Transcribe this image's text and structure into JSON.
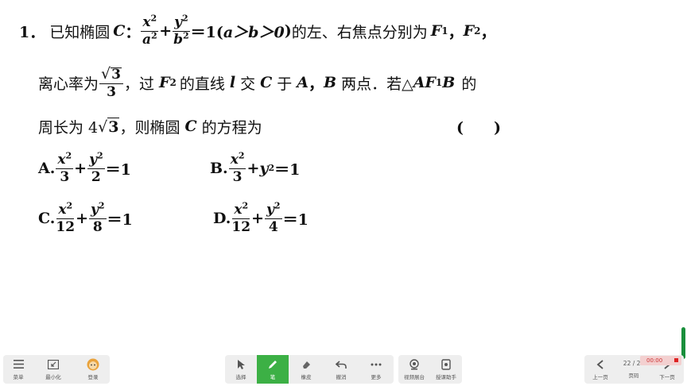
{
  "question": {
    "number": "1．",
    "line1": {
      "t1": "已知椭圆",
      "C": "C",
      "colon": "：",
      "x": "x",
      "two": "2",
      "a": "a",
      "plus": "+",
      "y": "y",
      "b": "b",
      "eq": "＝1(",
      "cond": "a＞b＞0",
      "close": ")",
      "t2": "的左、右焦点分别为",
      "F": "F",
      "one": "1",
      "comma": "，",
      "F2": "F",
      "two2": "2",
      "comma2": "，"
    },
    "line2": {
      "t1": "离心率为",
      "sqrt3": "3",
      "den": "3",
      "t2": "，过",
      "F": "F",
      "sub2": "2",
      "t3": "的直线",
      "l": "l",
      "t4": "交",
      "C": "C",
      "t5": "于",
      "A": "A",
      "comma": "，",
      "B": "B",
      "t6": "两点．若△",
      "AF": "AF",
      "sub1": "1",
      "B2": "B",
      "t7": "的"
    },
    "line3": {
      "t1": "周长为 4",
      "sqrt3": "3",
      "t2": "，则椭圆",
      "C": "C",
      "t3": "的方程为",
      "paren": "(　　)"
    },
    "options": [
      {
        "label": "A.",
        "xden": "3",
        "yden": "2"
      },
      {
        "label": "B.",
        "xden": "3",
        "ytext": "y",
        "sq": "2"
      },
      {
        "label": "C.",
        "xden": "12",
        "yden": "8"
      },
      {
        "label": "D.",
        "xden": "12",
        "yden": "4"
      }
    ],
    "x": "x",
    "y": "y",
    "two": "2",
    "plus": "+",
    "eq1": "＝1"
  },
  "toolbar": {
    "left": [
      {
        "icon": "menu-icon",
        "label": "菜单"
      },
      {
        "icon": "minimize-icon",
        "label": "最小化"
      },
      {
        "icon": "avatar-icon",
        "label": "登录"
      }
    ],
    "center": [
      {
        "icon": "cursor-icon",
        "label": "选择"
      },
      {
        "icon": "pen-icon",
        "label": "笔"
      },
      {
        "icon": "eraser-icon",
        "label": "橡皮"
      },
      {
        "icon": "undo-icon",
        "label": "撤消"
      },
      {
        "icon": "more-icon",
        "label": "更多"
      }
    ],
    "center2": [
      {
        "icon": "camera-icon",
        "label": "视频展台"
      },
      {
        "icon": "assistant-icon",
        "label": "授课助手"
      }
    ],
    "right": {
      "prev": "上一页",
      "page": "22 / 28",
      "page_label": "页码",
      "next": "下一页"
    },
    "timer": "00:00",
    "active_color": "#3cb045"
  }
}
